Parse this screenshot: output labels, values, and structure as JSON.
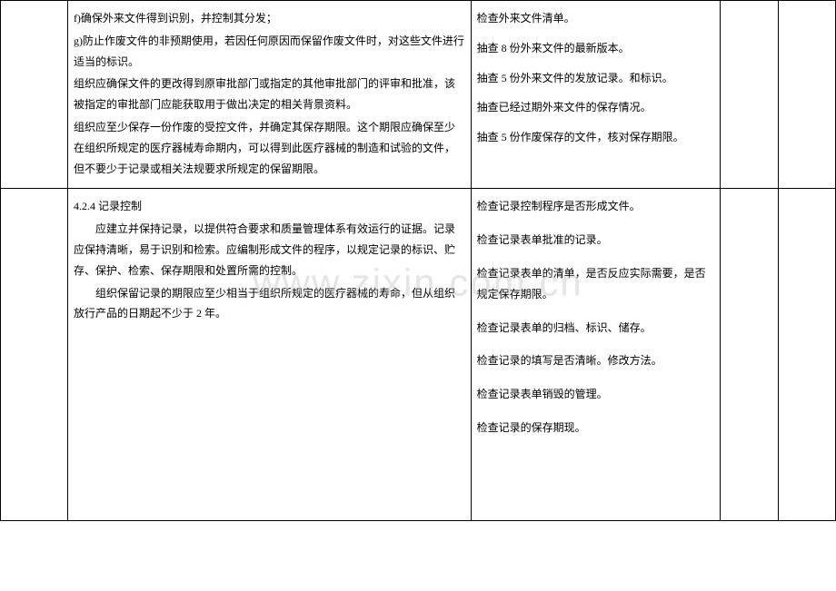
{
  "watermark": "www.zixin.com.cn",
  "rows": [
    {
      "requirements": [
        "f)确保外来文件得到识别，并控制其分发；",
        "g)防止作废文件的非预期使用，若因任何原因而保留作废文件时，对这些文件进行适当的标识。",
        "组织应确保文件的更改得到原审批部门或指定的其他审批部门的评审和批准，该被指定的审批部门应能获取用于做出决定的相关背景资料。",
        "组织应至少保存一份作废的受控文件，并确定其保存期限。这个期限应确保至少在组织所规定的医疗器械寿命期内，可以得到此医疗器械的制造和试验的文件，但不要少于记录或相关法规要求所规定的保留期限。"
      ],
      "checks": [
        "检查外来文件清单。",
        "抽查 8 份外来文件的最新版本。",
        "抽查 5 份外来文件的发放记录。和标识。",
        "抽查已经过期外来文件的保存情况。",
        "抽查 5 份作废保存的文件，核对保存期限。"
      ]
    },
    {
      "title": "4.2.4 记录控制",
      "requirements_indent": [
        "应建立并保持记录，以提供符合要求和质量管理体系有效运行的证据。记录应保持清晰，易于识别和检索。应编制形成文件的程序，以规定记录的标识、贮存、保护、检索、保存期限和处置所需的控制。",
        "组织保留记录的期限应至少相当于组织所规定的医疗器械的寿命，但从组织放行产品的日期起不少于 2 年。"
      ],
      "checks": [
        "检查记录控制程序是否形成文件。",
        "检查记录表单批准的记录。",
        "检查记录表单的清单，是否反应实际需要，是否规定保存期限。",
        "检查记录表单的归档、标识、储存。",
        "检查记录的填写是否清晰。修改方法。",
        "",
        "检查记录表单销毁的管理。",
        "检查记录的保存期现。"
      ]
    }
  ]
}
